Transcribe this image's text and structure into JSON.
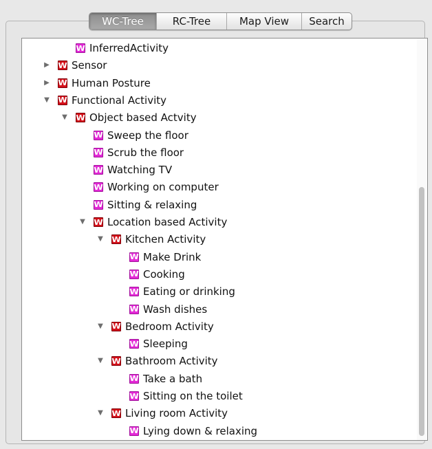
{
  "tabs": [
    {
      "label": "WC-Tree",
      "active": true
    },
    {
      "label": "RC-Tree",
      "active": false
    },
    {
      "label": "Map View",
      "active": false
    },
    {
      "label": "Search",
      "active": false
    }
  ],
  "tree": {
    "rows": [
      {
        "label": "InferredActivity",
        "depth": 1,
        "toggle": "none",
        "icon": "leaf-w-icon"
      },
      {
        "label": "Sensor",
        "depth": 0,
        "toggle": "collapsed",
        "icon": "folder-w-icon"
      },
      {
        "label": "Human Posture",
        "depth": 0,
        "toggle": "collapsed",
        "icon": "folder-w-icon"
      },
      {
        "label": "Functional Activity",
        "depth": 0,
        "toggle": "expanded",
        "icon": "folder-w-icon"
      },
      {
        "label": "Object based Actvity",
        "depth": 1,
        "toggle": "expanded",
        "icon": "folder-w-icon"
      },
      {
        "label": "Sweep the floor",
        "depth": 2,
        "toggle": "none",
        "icon": "leaf-w-icon"
      },
      {
        "label": "Scrub the floor",
        "depth": 2,
        "toggle": "none",
        "icon": "leaf-w-icon"
      },
      {
        "label": "Watching TV",
        "depth": 2,
        "toggle": "none",
        "icon": "leaf-w-icon"
      },
      {
        "label": "Working on computer",
        "depth": 2,
        "toggle": "none",
        "icon": "leaf-w-icon"
      },
      {
        "label": "Sitting & relaxing",
        "depth": 2,
        "toggle": "none",
        "icon": "leaf-w-icon"
      },
      {
        "label": "Location based Activity",
        "depth": 2,
        "toggle": "expanded",
        "icon": "folder-w-icon"
      },
      {
        "label": "Kitchen Activity",
        "depth": 3,
        "toggle": "expanded",
        "icon": "folder-w-icon"
      },
      {
        "label": "Make Drink",
        "depth": 4,
        "toggle": "none",
        "icon": "leaf-w-icon"
      },
      {
        "label": "Cooking",
        "depth": 4,
        "toggle": "none",
        "icon": "leaf-w-icon"
      },
      {
        "label": "Eating or drinking",
        "depth": 4,
        "toggle": "none",
        "icon": "leaf-w-icon"
      },
      {
        "label": "Wash dishes",
        "depth": 4,
        "toggle": "none",
        "icon": "leaf-w-icon"
      },
      {
        "label": "Bedroom Activity",
        "depth": 3,
        "toggle": "expanded",
        "icon": "folder-w-icon"
      },
      {
        "label": "Sleeping",
        "depth": 4,
        "toggle": "none",
        "icon": "leaf-w-icon"
      },
      {
        "label": "Bathroom Activity",
        "depth": 3,
        "toggle": "expanded",
        "icon": "folder-w-icon"
      },
      {
        "label": "Take a bath",
        "depth": 4,
        "toggle": "none",
        "icon": "leaf-w-icon"
      },
      {
        "label": "Sitting on the toilet",
        "depth": 4,
        "toggle": "none",
        "icon": "leaf-w-icon"
      },
      {
        "label": "Living room Activity",
        "depth": 3,
        "toggle": "expanded",
        "icon": "folder-w-icon"
      },
      {
        "label": "Lying down & relaxing",
        "depth": 4,
        "toggle": "none",
        "icon": "leaf-w-icon"
      }
    ]
  },
  "icon_glyph": "W",
  "scroll_thumb_start": 0.37,
  "scroll_thumb_end": 0.99,
  "colors": {
    "leaf_icon": "#e329d6",
    "folder_icon": "#d4101a",
    "tab_active": "#9a9a9a"
  }
}
